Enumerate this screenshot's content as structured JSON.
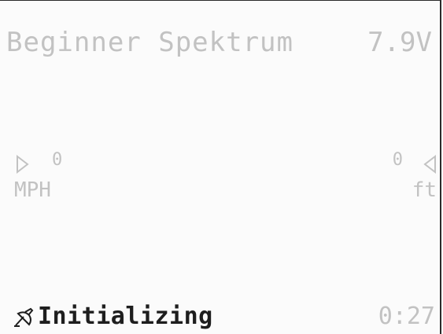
{
  "header": {
    "model_name": "Beginner Spektrum",
    "voltage": "7.9V"
  },
  "speed": {
    "value": "0",
    "unit": "MPH",
    "icon": "arrow-right-outline-icon"
  },
  "altitude": {
    "value": "0",
    "unit": "ft",
    "icon": "arrow-left-outline-icon"
  },
  "status": {
    "icon": "satellite-icon",
    "text": "Initializing",
    "timer": "0:27"
  },
  "colors": {
    "dim_text": "#c2c2c2",
    "active_text": "#1e1e1e",
    "background": "#fbfbfb",
    "border": "#2a2a2a"
  }
}
